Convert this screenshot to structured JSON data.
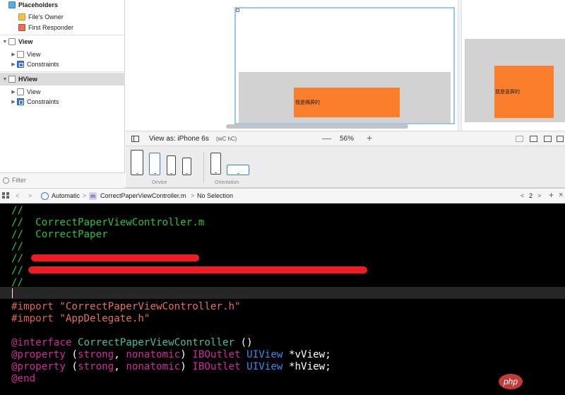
{
  "outline": {
    "placeholders_label": "Placeholders",
    "files_owner_label": "File's Owner",
    "first_responder_label": "First Responder",
    "view_scene_label": "View",
    "view_child_label": "View",
    "view_constraints_label": "Constraints",
    "hview_scene_label": "HView",
    "hview_child_label": "View",
    "hview_constraints_label": "Constraints",
    "filter_placeholder": "Filter"
  },
  "canvas": {
    "landscape_label": "我是横屏的",
    "portrait_label": "我是竖屏的",
    "orange_color": "#fb7e2c",
    "gray_color": "#d2d2d2"
  },
  "viewas": {
    "label": "View as: iPhone 6s",
    "size_class": "(wC hC)",
    "zoom_minus": "—",
    "zoom_level": "56%",
    "zoom_plus": "+"
  },
  "devices": {
    "device_label": "Device",
    "orientation_label": "Orientation",
    "selected_color": "#2f82e8"
  },
  "jumpbar": {
    "back": "<",
    "forward": ">",
    "automatic": "Automatic",
    "sep1": ">",
    "file": "CorrectPaperViewController.m",
    "sep2": ">",
    "selection": "No Selection",
    "prev_issue": "<",
    "issue_count": "2",
    "next_issue": ">",
    "add": "+",
    "close": "×"
  },
  "code": {
    "line1": "//",
    "line2": "//  CorrectPaperViewController.m",
    "line3": "//  CorrectPaper",
    "line4": "//",
    "line5": "//",
    "line6": "//",
    "line7": "//",
    "import1_kw": "#import",
    "import1_str": "\"CorrectPaperViewController.h\"",
    "import2_kw": "#import",
    "import2_str": "\"AppDelegate.h\"",
    "interface_kw": "@interface",
    "interface_cls": "CorrectPaperViewController",
    "interface_rest": "()",
    "property_kw": "@property",
    "attr_open": "(",
    "attr_strong": "strong",
    "attr_comma": ",",
    "attr_nonatomic": "nonatomic",
    "attr_close": ")",
    "iboutlet": "IBOutlet",
    "uiview": "UIView",
    "var1": "*vView;",
    "var2": "*hView;",
    "end_kw": "@end"
  },
  "watermark": "php"
}
